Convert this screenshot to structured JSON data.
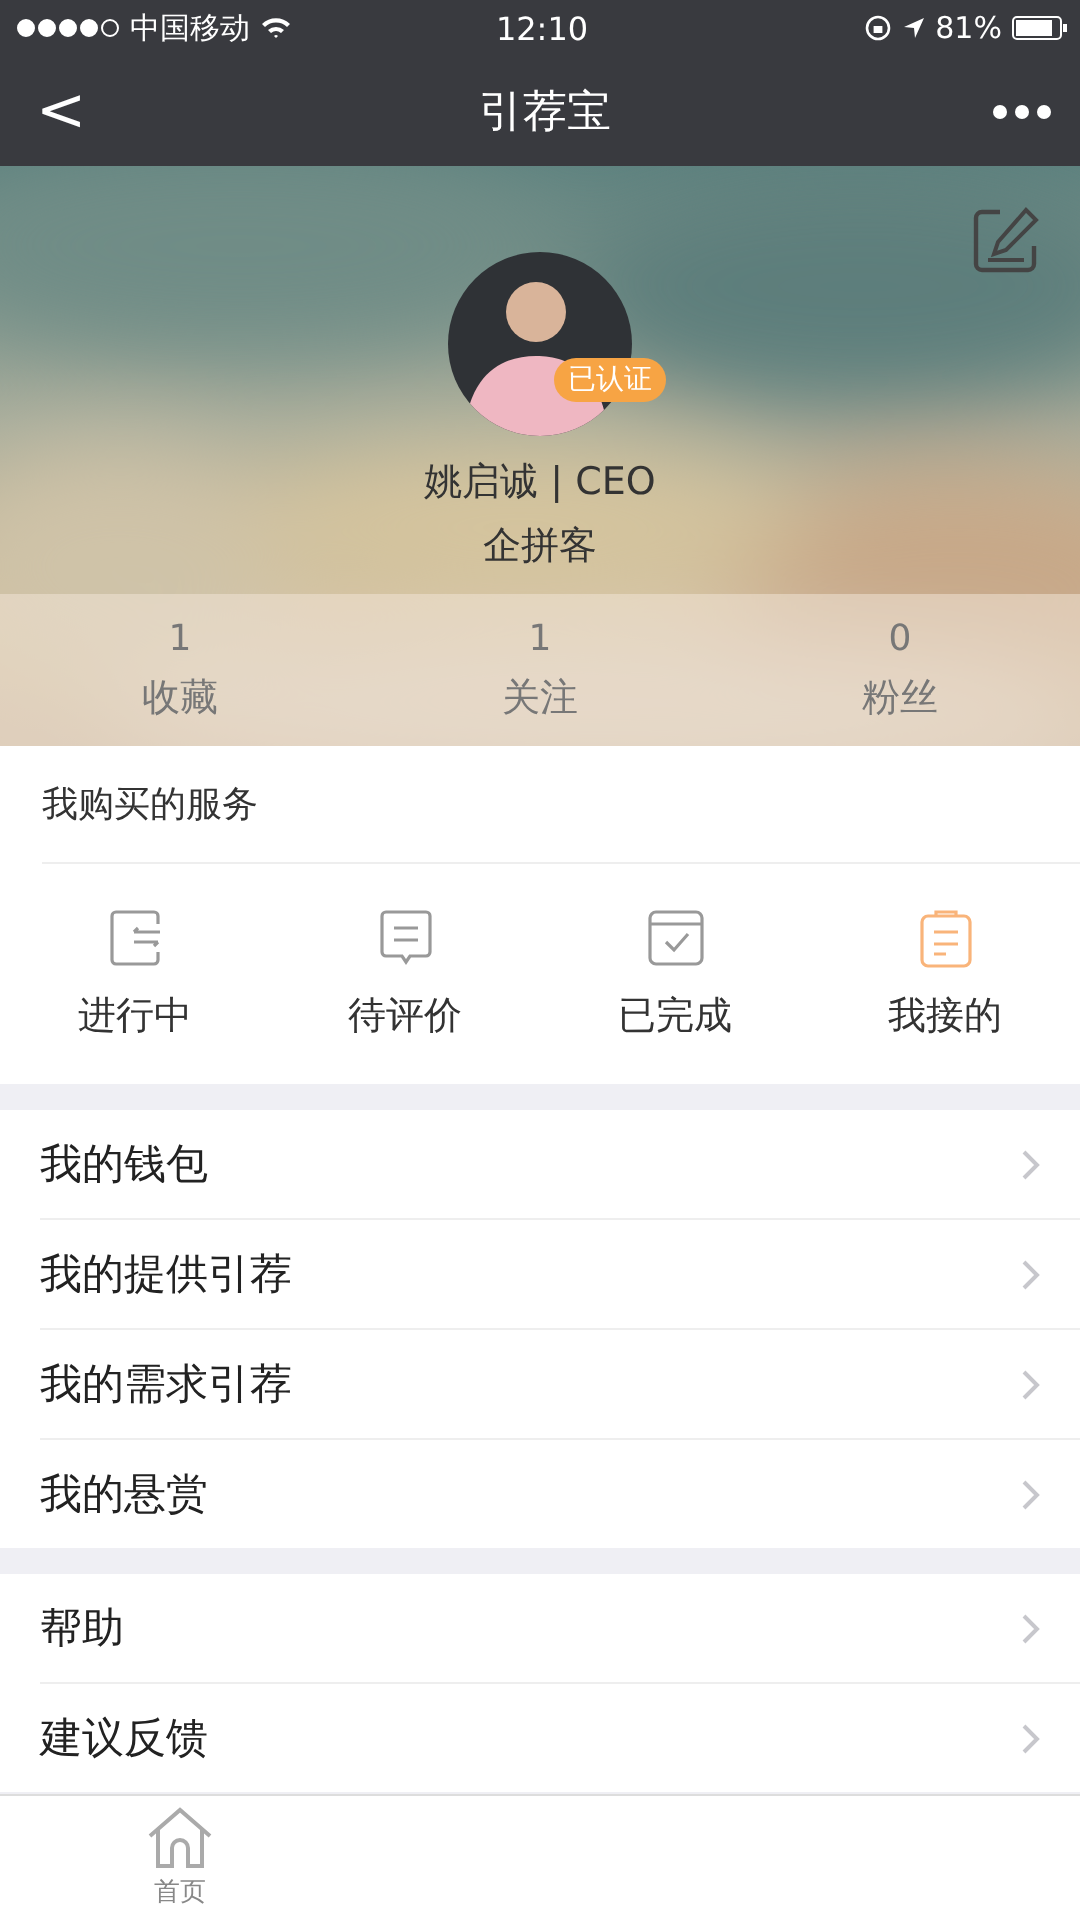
{
  "status_bar": {
    "carrier": "中国移动",
    "time": "12:10",
    "battery": "81%"
  },
  "nav": {
    "back": "<",
    "title": "引荐宝"
  },
  "profile": {
    "badge": "已认证",
    "name": "姚启诚 | CEO",
    "company": "企拼客"
  },
  "stats": [
    {
      "count": "1",
      "label": "收藏"
    },
    {
      "count": "1",
      "label": "关注"
    },
    {
      "count": "0",
      "label": "粉丝"
    }
  ],
  "services": {
    "title": "我购买的服务",
    "items": [
      {
        "kind": "progress",
        "label": "进行中",
        "color": "#999999"
      },
      {
        "kind": "review",
        "label": "待评价",
        "color": "#999999"
      },
      {
        "kind": "done",
        "label": "已完成",
        "color": "#999999"
      },
      {
        "kind": "clipboard",
        "label": "我接的",
        "color": "#f9b47a"
      }
    ]
  },
  "menu_groups": [
    [
      {
        "label": "我的钱包"
      },
      {
        "label": "我的提供引荐"
      },
      {
        "label": "我的需求引荐"
      },
      {
        "label": "我的悬赏"
      }
    ],
    [
      {
        "label": "帮助"
      },
      {
        "label": "建议反馈"
      }
    ]
  ],
  "tab_bar": [
    {
      "label": "首页"
    }
  ]
}
